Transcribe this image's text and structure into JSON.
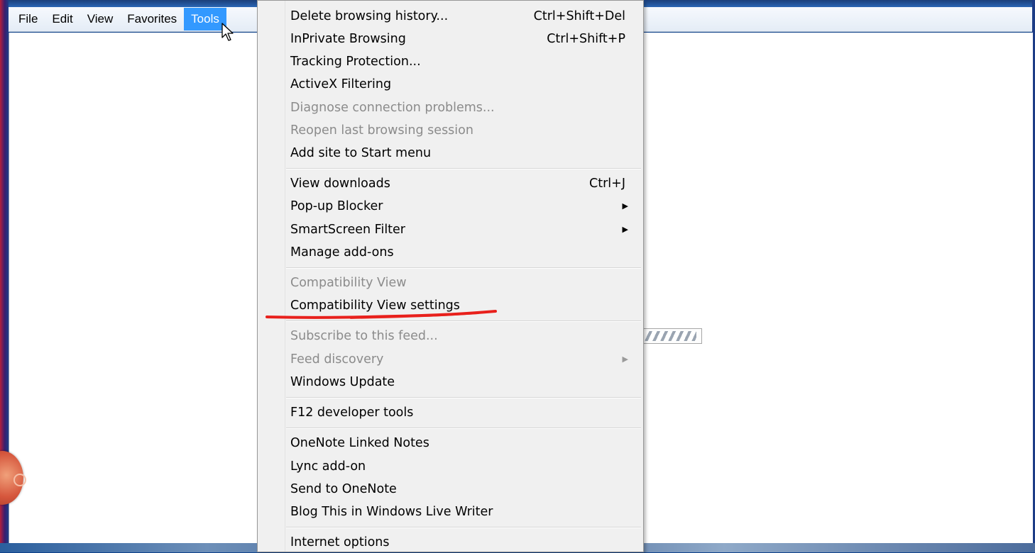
{
  "menubar": {
    "items": [
      {
        "label": "File",
        "active": false
      },
      {
        "label": "Edit",
        "active": false
      },
      {
        "label": "View",
        "active": false
      },
      {
        "label": "Favorites",
        "active": false
      },
      {
        "label": "Tools",
        "active": true
      }
    ]
  },
  "tools_menu": {
    "items": [
      {
        "label": "Delete browsing history...",
        "shortcut": "Ctrl+Shift+Del",
        "enabled": true
      },
      {
        "label": "InPrivate Browsing",
        "shortcut": "Ctrl+Shift+P",
        "enabled": true
      },
      {
        "label": "Tracking Protection...",
        "enabled": true
      },
      {
        "label": "ActiveX Filtering",
        "enabled": true
      },
      {
        "label": "Diagnose connection problems...",
        "enabled": false
      },
      {
        "label": "Reopen last browsing session",
        "enabled": false
      },
      {
        "label": "Add site to Start menu",
        "enabled": true
      },
      {
        "label": "View downloads",
        "shortcut": "Ctrl+J",
        "enabled": true
      },
      {
        "label": "Pop-up Blocker",
        "submenu": true,
        "enabled": true
      },
      {
        "label": "SmartScreen Filter",
        "submenu": true,
        "enabled": true
      },
      {
        "label": "Manage add-ons",
        "enabled": true
      },
      {
        "label": "Compatibility View",
        "enabled": false
      },
      {
        "label": "Compatibility View settings",
        "enabled": true,
        "highlighted_annotation": true
      },
      {
        "label": "Subscribe to this feed...",
        "enabled": false
      },
      {
        "label": "Feed discovery",
        "submenu": true,
        "enabled": false
      },
      {
        "label": "Windows Update",
        "enabled": true
      },
      {
        "label": "F12 developer tools",
        "enabled": true
      },
      {
        "label": "OneNote Linked Notes",
        "enabled": true
      },
      {
        "label": "Lync add-on",
        "enabled": true
      },
      {
        "label": "Send to OneNote",
        "enabled": true
      },
      {
        "label": "Blog This in Windows Live Writer",
        "enabled": true
      },
      {
        "label": "Internet options",
        "enabled": true
      }
    ]
  },
  "annotation": {
    "color": "#e8201c"
  },
  "colors": {
    "menu_highlight": "#3399ff",
    "disabled_text": "#8b8b8b"
  }
}
